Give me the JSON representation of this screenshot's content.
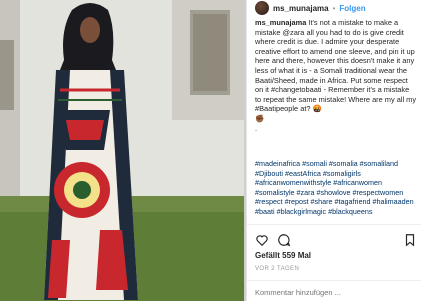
{
  "post": {
    "username": "ms_munajama",
    "separator": "•",
    "follow_label": "Folgen",
    "caption_user": "ms_munajama",
    "caption_text": " It's not a mistake to make a mistake @zara all you had to do is give credit where credit is due. I admire your desperate creative effort to amend one sleeve, and pin it up here and there, however this doesn't make it any less of what it is - a Somali traditional wear the Baati/Sheed, made in Africa. Put some respect on it #changetobaati - Remember it's a mistake to repeat the same mistake! Where are my all my #Baatipeople at? 🤬",
    "emoji_line": "✊🏾",
    "dot_line": ".",
    "hashtags": "#madeinafrica #somali #somalia #somaliland #Djibouti #eastAfrica #somaligirls #africanwomenwithstyle #africanwomen #somalistyle #zara #showlove #respectwomen #respect #repost #share #tagafriend #halimaaden #baati #blackgirlmagic #blackqueens",
    "likes_text": "Gefällt 559 Mal",
    "timestamp": "VOR 2 TAGEN",
    "comment_placeholder": "Kommentar hinzufügen ..."
  },
  "icons": {
    "like": "heart-icon",
    "comment": "speech-bubble-icon",
    "save": "bookmark-icon"
  },
  "colors": {
    "link": "#003569",
    "follow": "#3897f0",
    "text": "#262626",
    "muted": "#999999"
  }
}
